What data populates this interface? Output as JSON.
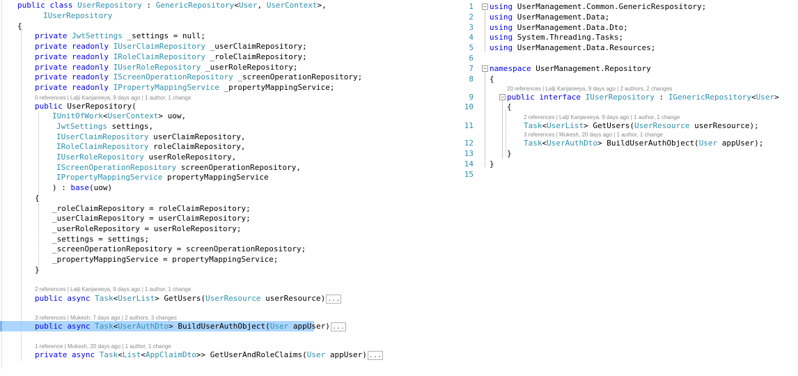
{
  "left_editor": {
    "class_decl": {
      "kw1": "public",
      "kw2": "class",
      "name": "UserRepository",
      "colon": " : ",
      "base": "GenericRepository",
      "lt": "<",
      "arg1": "User",
      "comma": ", ",
      "arg2": "UserContext",
      "gt": ">,"
    },
    "interface_line": "IUserRepository",
    "open_brace": "{",
    "fields": [
      {
        "mods": "private",
        "type": "JwtSettings",
        "rest": " _settings = null;"
      },
      {
        "mods": "private readonly",
        "type": "IUserClaimRepository",
        "rest": " _userClaimRepository;"
      },
      {
        "mods": "private readonly",
        "type": "IRoleClaimRepository",
        "rest": " _roleClaimRepository;"
      },
      {
        "mods": "private readonly",
        "type": "IUserRoleRepository",
        "rest": " _userRoleRepository;"
      },
      {
        "mods": "private readonly",
        "type": "IScreenOperationRepository",
        "rest": " _screenOperationRepository;"
      },
      {
        "mods": "private readonly",
        "type": "IPropertyMappingService",
        "rest": " _propertyMappingService;"
      }
    ],
    "ctor_lens": "0 references | Lalji Kanjareeya, 9 days ago | 1 author, 1 change",
    "ctor_decl": {
      "kw": "public",
      "name": " UserRepository("
    },
    "ctor_params": [
      {
        "type": "IUnitOfWork",
        "lt": "<",
        "arg": "UserContext",
        "rest": "> uow,"
      },
      {
        "type": "JwtSettings",
        "rest": " settings,"
      },
      {
        "type": "IUserClaimRepository",
        "rest": " userClaimRepository,"
      },
      {
        "type": "IRoleClaimRepository",
        "rest": " roleClaimRepository,"
      },
      {
        "type": "IUserRoleRepository",
        "rest": " userRoleRepository,"
      },
      {
        "type": "IScreenOperationRepository",
        "rest": " screenOperationRepository,"
      },
      {
        "type": "IPropertyMappingService",
        "rest": " propertyMappingService"
      }
    ],
    "ctor_close": {
      "pre": ") : ",
      "kw": "base",
      "rest": "(uow)"
    },
    "body_open": "{",
    "body_lines": [
      "_roleClaimRepository = roleClaimRepository;",
      "_userClaimRepository = userClaimRepository;",
      "_userRoleRepository = userRoleRepository;",
      "_settings = settings;",
      "_screenOperationRepository = screenOperationRepository;",
      "_propertyMappingService = propertyMappingService;"
    ],
    "body_close": "}",
    "methods": [
      {
        "lens": "2 references | Lalji Kanjareeya, 9 days ago | 1 author, 1 change",
        "kw": "public async",
        "t1": "Task",
        "lt": "<",
        "t2": "UserList",
        "gt": ">",
        "name": " GetUsers(",
        "ptype": "UserResource",
        "prest": " userResource)",
        "ellipsis": "..."
      },
      {
        "lens": "3 references | Mukesh, 7 days ago | 2 authors, 3 changes",
        "kw": "public async",
        "t1": "Task",
        "lt": "<",
        "t2": "UserAuthDto",
        "gt": ">",
        "name": " BuildUserAuthObject(",
        "ptype": "User",
        "prest": " appUser)",
        "ellipsis": "..."
      },
      {
        "lens": "1 reference | Mukesh, 20 days ago | 1 author, 1 change",
        "kw": "private async",
        "t1": "Task",
        "lt": "<",
        "t2": "List",
        "gt": "<",
        "t3": "AppClaimDto",
        "gt2": ">>",
        "name": " GetUserAndRoleClaims(",
        "ptype": "User",
        "prest": " appUser)",
        "ellipsis": "..."
      }
    ]
  },
  "right_editor": {
    "line_numbers": [
      "1",
      "2",
      "3",
      "4",
      "5",
      "6",
      "7",
      "8",
      "9",
      "10",
      "11",
      "12",
      "13",
      "14",
      "15"
    ],
    "usings": [
      "UserManagement.Common.GenericRespository;",
      "UserManagement.Data;",
      "UserManagement.Data.Dto;",
      "System.Threading.Tasks;",
      "UserManagement.Data.Resources;"
    ],
    "using_kw": "using",
    "namespace_kw": "namespace",
    "namespace_name": " UserManagement.Repository",
    "open_brace": "{",
    "iface_lens": "20 references | Lalji Kanjareeya, 9 days ago | 2 authors, 2 changes",
    "iface": {
      "kw": "public interface",
      "name": "IUserRepository",
      "colon": " : ",
      "base": "IGenericRepository",
      "lt": "<",
      "arg": "User",
      "gt": ">"
    },
    "iface_open": "{",
    "members": [
      {
        "lens": "2 references | Lalji Kanjareeya, 9 days ago | 1 author, 1 change",
        "t1": "Task",
        "lt": "<",
        "t2": "UserList",
        "gt": ">",
        "name": " GetUsers(",
        "ptype": "UserResource",
        "prest": " userResource);"
      },
      {
        "lens": "3 references | Mukesh, 20 days ago | 1 author, 1 change",
        "t1": "Task",
        "lt": "<",
        "t2": "UserAuthDto",
        "gt": ">",
        "name": " BuildUserAuthObject(",
        "ptype": "User",
        "prest": " appUser);"
      }
    ],
    "iface_close": "}",
    "close_brace": "}"
  }
}
